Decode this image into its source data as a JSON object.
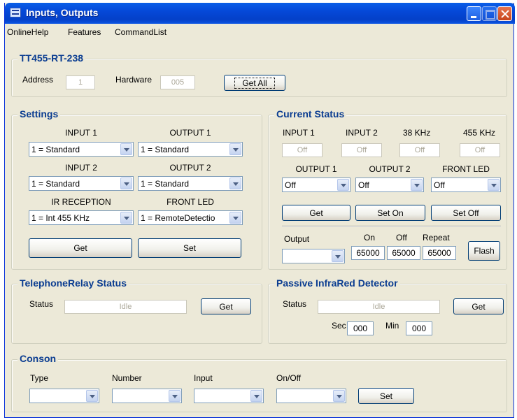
{
  "window": {
    "title": "Inputs, Outputs"
  },
  "menu": [
    "OnlineHelp",
    "Features",
    "CommandList"
  ],
  "device": {
    "legend": "TT455-RT-238",
    "address_label": "Address",
    "address_value": "1",
    "hardware_label": "Hardware",
    "hardware_value": "005",
    "get_all_label": "Get All"
  },
  "settings": {
    "legend": "Settings",
    "input1_label": "INPUT 1",
    "input1_value": "1 = Standard",
    "output1_label": "OUTPUT 1",
    "output1_value": "1 = Standard",
    "input2_label": "INPUT 2",
    "input2_value": "1 = Standard",
    "output2_label": "OUTPUT 2",
    "output2_value": "1 = Standard",
    "ir_label": "IR RECEPTION",
    "ir_value": "1 = Int 455 KHz",
    "front_led_label": "FRONT LED",
    "front_led_value": "1 = RemoteDetectio",
    "get_label": "Get",
    "set_label": "Set"
  },
  "current_status": {
    "legend": "Current Status",
    "input1_label": "INPUT 1",
    "input1_value": "Off",
    "input2_label": "INPUT 2",
    "input2_value": "Off",
    "khz38_label": "38 KHz",
    "khz38_value": "Off",
    "khz455_label": "455 KHz",
    "khz455_value": "Off",
    "output1_label": "OUTPUT 1",
    "output1_value": "Off",
    "output2_label": "OUTPUT 2",
    "output2_value": "Off",
    "front_led_label": "FRONT LED",
    "front_led_value": "Off",
    "get_label": "Get",
    "set_on_label": "Set On",
    "set_off_label": "Set Off",
    "output_label": "Output",
    "output_value": "",
    "on_label": "On",
    "on_value": "65000",
    "off_label": "Off",
    "off_value": "65000",
    "repeat_label": "Repeat",
    "repeat_value": "65000",
    "flash_label": "Flash"
  },
  "telephone_relay": {
    "legend": "TelephoneRelay Status",
    "status_label": "Status",
    "status_value": "Idle",
    "get_label": "Get"
  },
  "pir": {
    "legend": "Passive InfraRed Detector",
    "status_label": "Status",
    "status_value": "Idle",
    "get_label": "Get",
    "sec_label": "Sec",
    "sec_value": "000",
    "min_label": "Min",
    "min_value": "000"
  },
  "conson": {
    "legend": "Conson",
    "type_label": "Type",
    "type_value": "",
    "number_label": "Number",
    "number_value": "",
    "input_label": "Input",
    "input_value": "",
    "onoff_label": "On/Off",
    "onoff_value": "",
    "set_label": "Set"
  },
  "colors": {
    "titlebar": "#0548d8",
    "legend_text": "#0b3d91",
    "window_bg": "#ece9d8"
  }
}
